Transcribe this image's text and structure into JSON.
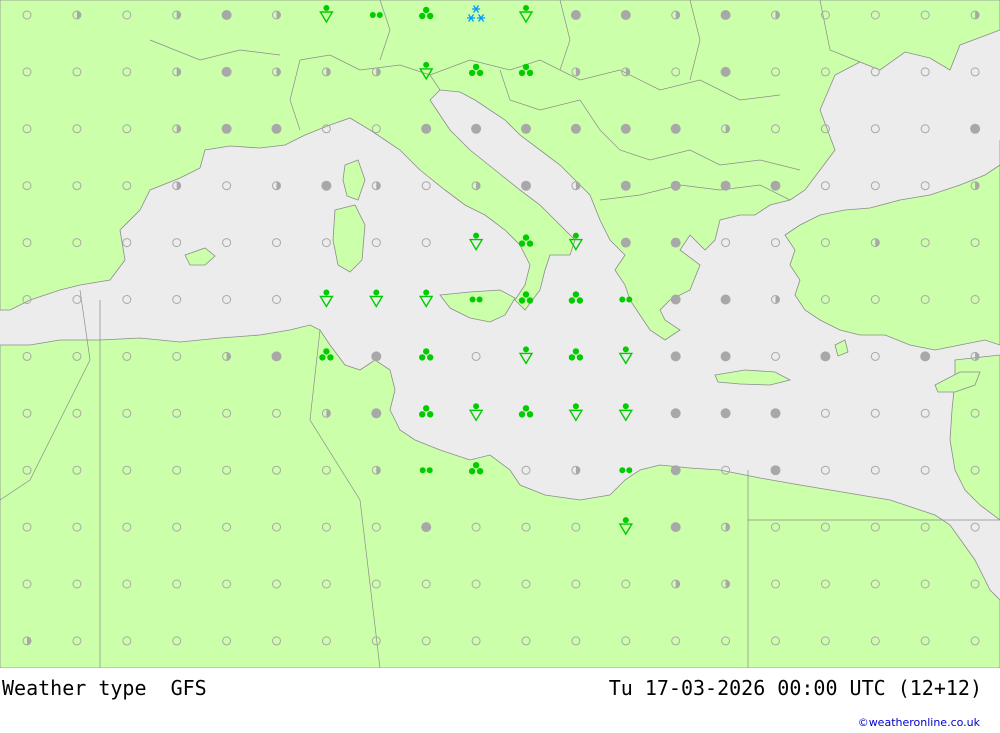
{
  "map": {
    "colors": {
      "land": "#ccffaa",
      "sea": "#ececec",
      "border": "#8c8c8c",
      "coast": "#8c8c8c",
      "symbol_dry": "#a8a8a8",
      "symbol_rain": "#00cc00",
      "symbol_snow": "#0099ff"
    },
    "rows": [
      "ohohfhfhdhdhfhcccccoohdlllllolol",
      "ohohohohffohooohoofp",
      "oooooohohffffffdfooof",
      "ohooohohfhffoooohfhffffooohooh",
      "ooooooooooohooohpccoooohooohooooh",
      "oooooooooooohooooohooooo",
      "ooohoooohfhffhfoooooooohfh",
      "oooooooooooooooooooooo",
      "ooooooooohoooooooooooo",
      "oooooooooooooooooooo",
      "ooooooooooooohoooooo",
      "oooooooooooooooooooooo"
    ],
    "grid": [
      [
        "o",
        "h",
        "o",
        "h",
        "f",
        "h",
        "s",
        "d",
        "r",
        "n",
        "s",
        "f",
        "f",
        "h",
        "f",
        "h",
        "o",
        "o",
        "o",
        "h"
      ],
      [
        "o",
        "o",
        "o",
        "h",
        "f",
        "h",
        "h",
        "h",
        "s",
        "r",
        "r",
        "h",
        "h",
        "o",
        "f",
        "o",
        "o",
        "o",
        "o",
        "o"
      ],
      [
        "o",
        "o",
        "o",
        "h",
        "f",
        "f",
        "o",
        "o",
        "f",
        "f",
        "f",
        "f",
        "f",
        "f",
        "h",
        "o",
        "o",
        "o",
        "o",
        "f"
      ],
      [
        "o",
        "o",
        "o",
        "h",
        "o",
        "h",
        "f",
        "h",
        "o",
        "h",
        "f",
        "h",
        "f",
        "f",
        "f",
        "f",
        "o",
        "o",
        "o",
        "h"
      ],
      [
        "o",
        "o",
        "o",
        "o",
        "o",
        "o",
        "o",
        "o",
        "o",
        "s",
        "r",
        "s",
        "f",
        "f",
        "o",
        "o",
        "o",
        "h",
        "o",
        "o"
      ],
      [
        "o",
        "o",
        "o",
        "o",
        "o",
        "o",
        "s",
        "s",
        "s",
        "d",
        "r",
        "r",
        "d",
        "f",
        "f",
        "h",
        "o",
        "o",
        "o",
        "o"
      ],
      [
        "o",
        "o",
        "o",
        "o",
        "h",
        "f",
        "r",
        "f",
        "r",
        "o",
        "s",
        "r",
        "s",
        "f",
        "f",
        "o",
        "f",
        "o",
        "f",
        "h"
      ],
      [
        "o",
        "o",
        "o",
        "o",
        "o",
        "o",
        "h",
        "f",
        "r",
        "s",
        "r",
        "s",
        "s",
        "f",
        "f",
        "f",
        "o",
        "o",
        "o",
        "o"
      ],
      [
        "o",
        "o",
        "o",
        "o",
        "o",
        "o",
        "o",
        "h",
        "d",
        "r",
        "o",
        "h",
        "d",
        "f",
        "o",
        "f",
        "o",
        "o",
        "o",
        "o"
      ],
      [
        "o",
        "o",
        "o",
        "o",
        "o",
        "o",
        "o",
        "o",
        "f",
        "o",
        "o",
        "o",
        "s",
        "f",
        "h",
        "o",
        "o",
        "o",
        "o",
        "o"
      ],
      [
        "o",
        "o",
        "o",
        "o",
        "o",
        "o",
        "o",
        "o",
        "o",
        "o",
        "o",
        "o",
        "o",
        "h",
        "h",
        "o",
        "o",
        "o",
        "o",
        "o"
      ],
      [
        "h",
        "o",
        "o",
        "o",
        "o",
        "o",
        "o",
        "o",
        "o",
        "o",
        "o",
        "o",
        "o",
        "o",
        "o",
        "o",
        "o",
        "o",
        "o",
        "o"
      ]
    ]
  },
  "footer": {
    "title": "Weather type  GFS",
    "validtime": "Tu 17-03-2026 00:00 UTC (12+12)",
    "credit": "©weatheronline.co.uk"
  }
}
